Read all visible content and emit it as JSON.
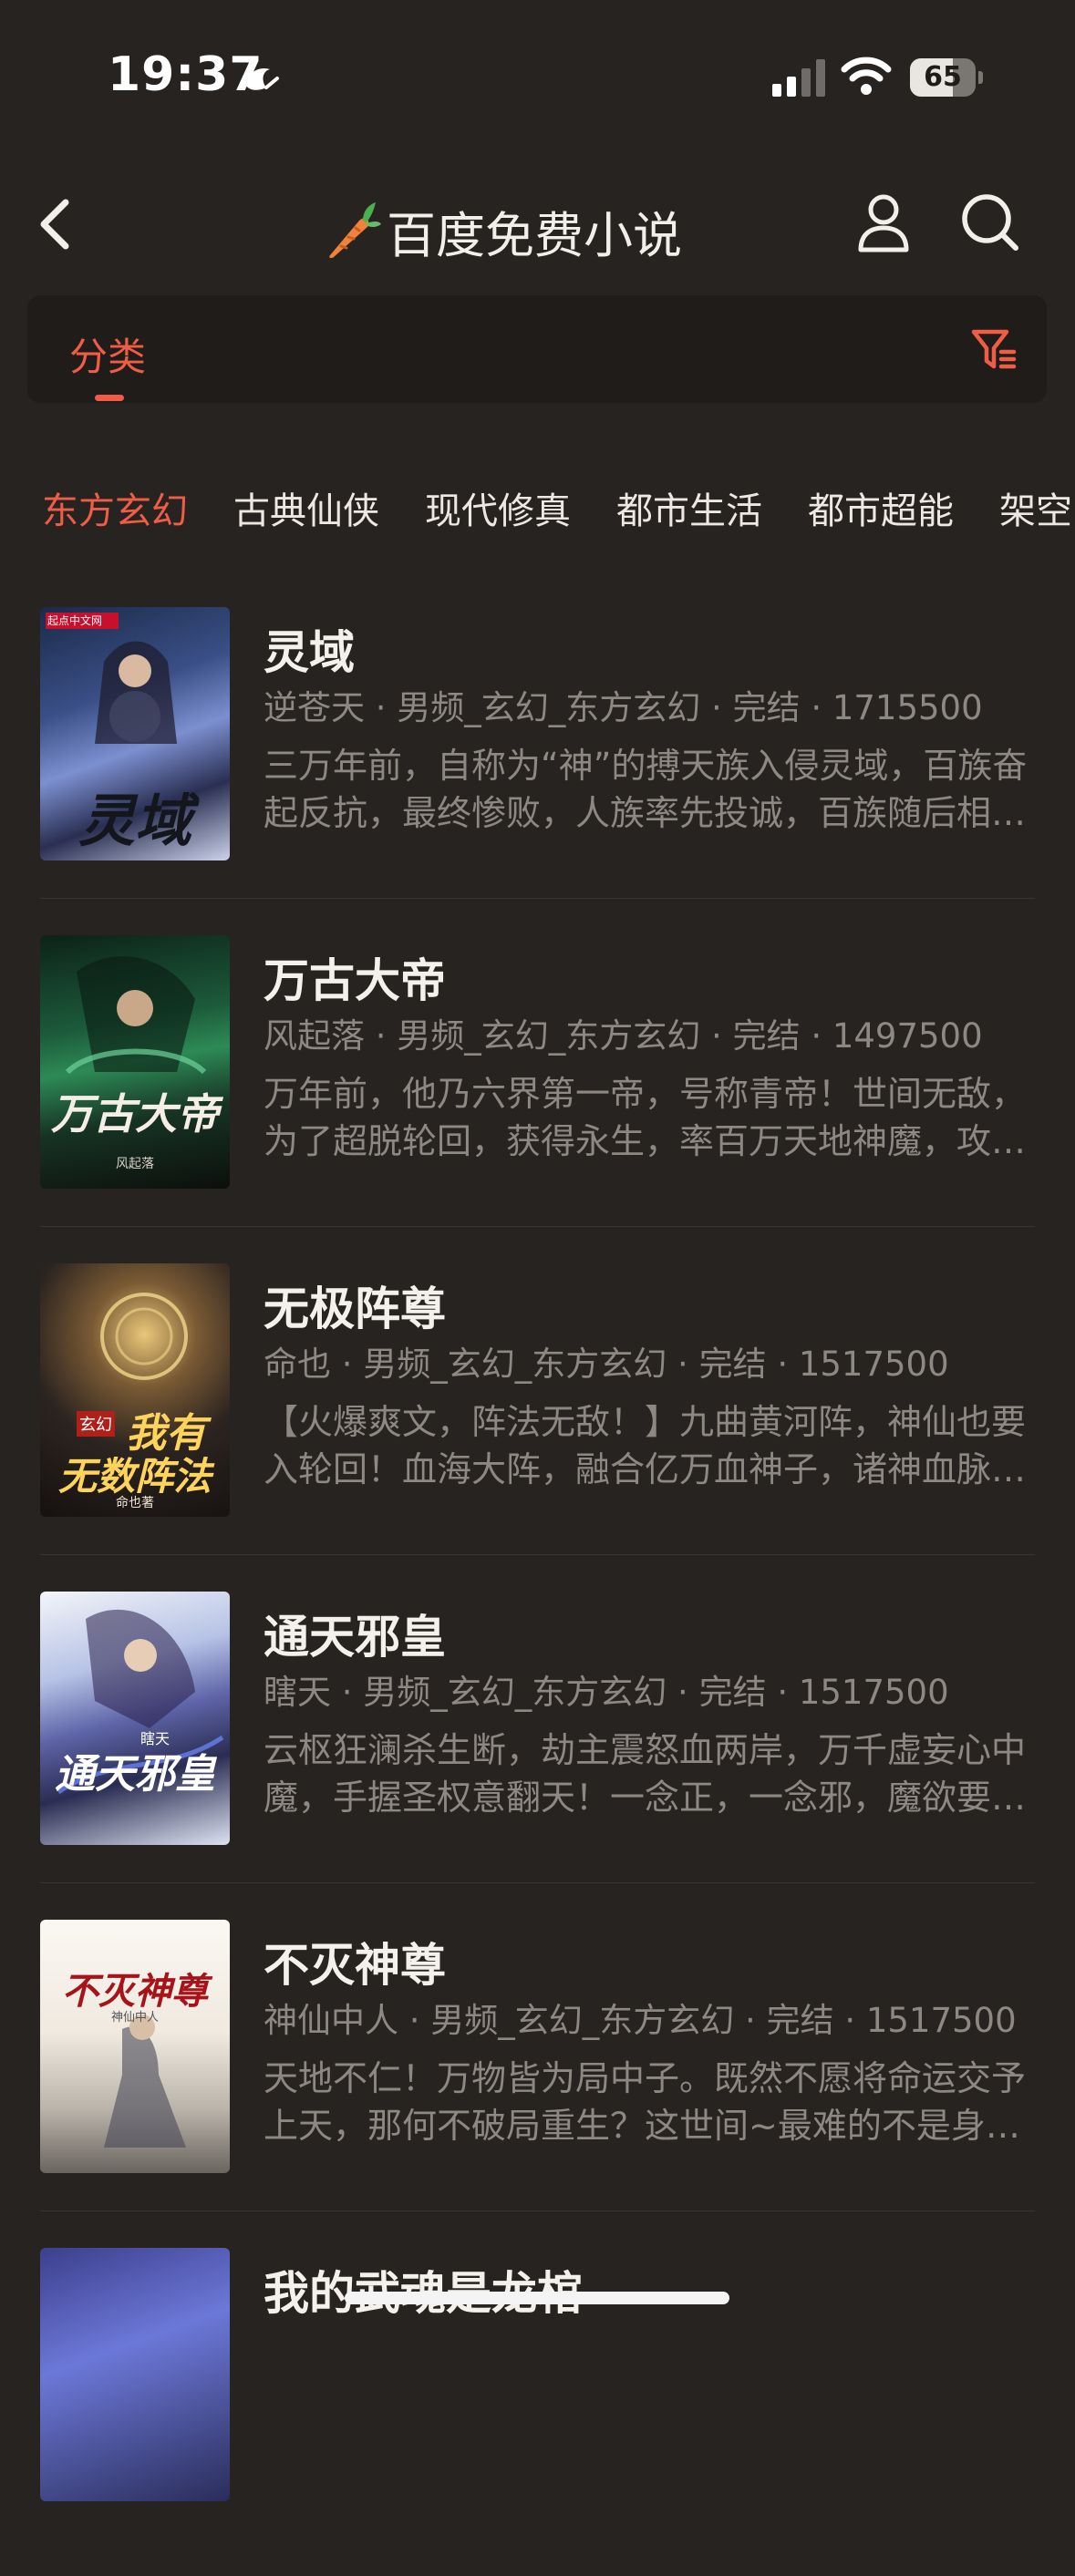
{
  "status_bar": {
    "time": "19:37",
    "battery_level": "65",
    "battery_fraction": 0.65
  },
  "nav": {
    "title": "百度免费小说"
  },
  "tab_bar": {
    "active_tab": "分类"
  },
  "categories": [
    "东方玄幻",
    "古典仙侠",
    "现代修真",
    "都市生活",
    "都市超能",
    "架空"
  ],
  "books": [
    {
      "title": "灵域",
      "meta": "逆苍天 · 男频_玄幻_东方玄幻 · 完结 · 1715500",
      "desc_line1": "三万年前，自称为“神”的搏天族入侵灵域，百族奋",
      "desc_line2": "起反抗，最终惨败，人族率先投诚，百族随后相…",
      "cover_badge": "起点中文网",
      "cover_text": "灵域"
    },
    {
      "title": "万古大帝",
      "meta": "风起落 · 男频_玄幻_东方玄幻 · 完结 · 1497500",
      "desc_line1": "万年前，他乃六界第一帝，号称青帝！世间无敌，",
      "desc_line2": "为了超脱轮回，获得永生，率百万天地神魔，攻…",
      "cover_text": "万古大帝",
      "cover_author": "风起落"
    },
    {
      "title": "无极阵尊",
      "meta": "命也 · 男频_玄幻_东方玄幻 · 完结 · 1517500",
      "desc_line1": "【火爆爽文，阵法无敌！】九曲黄河阵，神仙也要",
      "desc_line2": "入轮回！血海大阵，融合亿万血神子，诸神血脉…",
      "cover_text_1": "我有",
      "cover_text_2": "无数阵法",
      "cover_tag": "玄幻",
      "cover_author": "命也著"
    },
    {
      "title": "通天邪皇",
      "meta": "瞎天 · 男频_玄幻_东方玄幻 · 完结 · 1517500",
      "desc_line1": "云枢狂澜杀生断，劫主震怒血两岸，万千虚妄心中",
      "desc_line2": "魔，手握圣权意翻天！一念正，一念邪，魔欲要…",
      "cover_text": "通天邪皇",
      "cover_author": "瞎天"
    },
    {
      "title": "不灭神尊",
      "meta": "神仙中人 · 男频_玄幻_东方玄幻 · 完结 · 1517500",
      "desc_line1": "天地不仁！万物皆为局中子。既然不愿将命运交予",
      "desc_line2": "上天，那何不破局重生？这世间~最难的不是身…",
      "cover_text": "不灭神尊",
      "cover_author": "神仙中人"
    },
    {
      "title": "我的武魂是龙棺"
    }
  ],
  "colors": {
    "background": "#272321",
    "accent": "#F05D46",
    "muted_text": "#8E8882",
    "card": "#1F1C1A"
  }
}
